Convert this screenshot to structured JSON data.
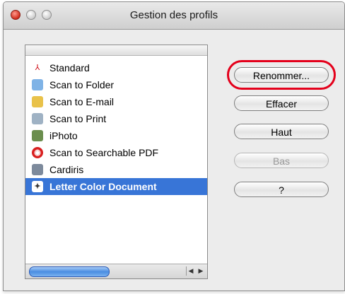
{
  "window": {
    "title": "Gestion des profils"
  },
  "profiles": [
    {
      "label": "Standard",
      "icon": "pdf-acrobat-icon"
    },
    {
      "label": "Scan to Folder",
      "icon": "folder-icon"
    },
    {
      "label": "Scan to E-mail",
      "icon": "email-icon"
    },
    {
      "label": "Scan to Print",
      "icon": "printer-icon"
    },
    {
      "label": "iPhoto",
      "icon": "iphoto-icon"
    },
    {
      "label": "Scan to Searchable PDF",
      "icon": "searchable-pdf-icon"
    },
    {
      "label": "Cardiris",
      "icon": "cardiris-icon"
    },
    {
      "label": "Letter Color Document",
      "icon": "scanner-profile-icon",
      "selected": true
    }
  ],
  "buttons": {
    "rename": "Renommer...",
    "delete": "Effacer",
    "up": "Haut",
    "down": "Bas",
    "help": "?"
  },
  "colors": {
    "selection": "#3875d7",
    "highlight_ring": "#e4001b"
  }
}
